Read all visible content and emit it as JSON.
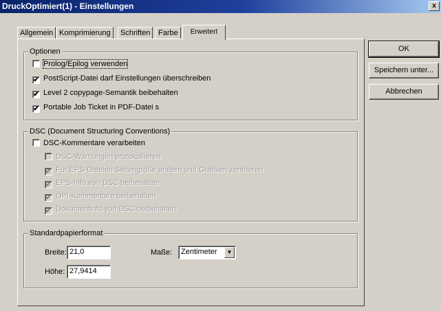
{
  "window": {
    "title": "DruckOptimiert(1) - Einstellungen",
    "close_glyph": "x"
  },
  "tabs": [
    {
      "label": "Allgemein"
    },
    {
      "label": "Komprimierung"
    },
    {
      "label": "Schriften"
    },
    {
      "label": "Farbe"
    },
    {
      "label": "Erweitert"
    }
  ],
  "active_tab": "Erweitert",
  "optionen": {
    "legend": "Optionen",
    "items": [
      {
        "label": "Prolog/Epilog verwenden",
        "checked": false
      },
      {
        "label": "PostScript-Datei darf Einstellungen überschreiben",
        "checked": true
      },
      {
        "label": "Level 2 copypage-Semantik beibehalten",
        "checked": true
      },
      {
        "label": "Portable Job Ticket in PDF-Datei s",
        "checked": true
      }
    ]
  },
  "dsc": {
    "legend": "DSC (Document Structuring Conventions)",
    "main": {
      "label": "DSC-Kommentare verarbeiten",
      "checked": false
    },
    "items": [
      {
        "label": "DSC-Warnungen protokollieren",
        "checked": false
      },
      {
        "label": "Für EPS-Dateien Seitengröße ändern und Grafiken zentrieren",
        "checked": true
      },
      {
        "label": "EPS-Info von DSC beibehalten",
        "checked": true
      },
      {
        "label": "OPI-Kommentare beibehalten",
        "checked": true
      },
      {
        "label": "Dokumentinfo von DSC beibehalten",
        "checked": true
      }
    ]
  },
  "papier": {
    "legend": "Standardpapierformat",
    "breite_label": "Breite:",
    "breite_value": "21,0",
    "hoehe_label": "Höhe:",
    "hoehe_value": "27,9414",
    "masse_label": "Maße:",
    "masse_value": "Zentimeter"
  },
  "buttons": {
    "ok": "OK",
    "save_as": "Speichern unter...",
    "cancel": "Abbrechen"
  },
  "check_glyph": "✔"
}
